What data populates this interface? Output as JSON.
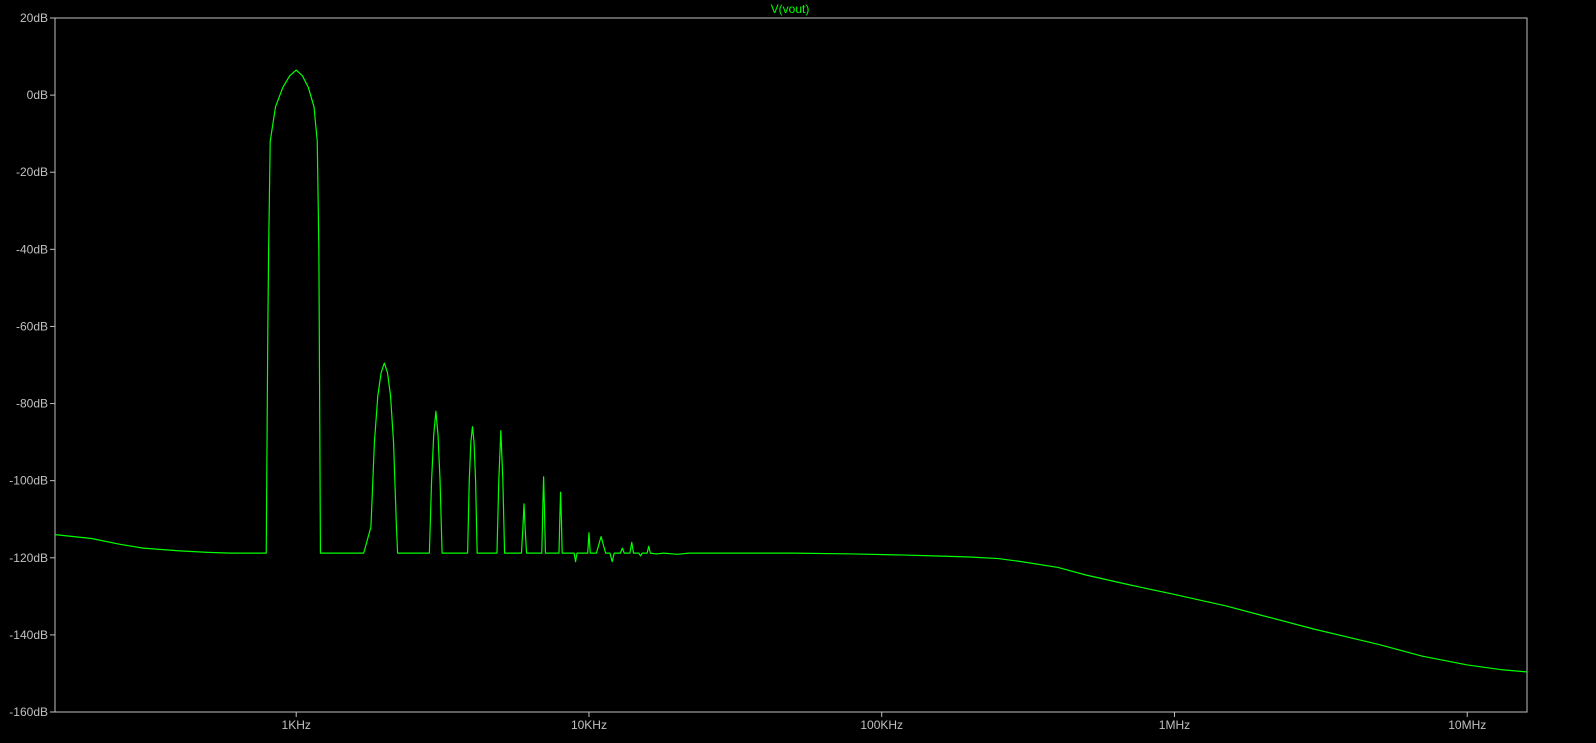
{
  "chart_data": {
    "type": "line",
    "title": "V(vout)",
    "xlabel": "",
    "ylabel": "",
    "x_scale": "log",
    "xlim": [
      150,
      16000000
    ],
    "ylim": [
      -160,
      20
    ],
    "grid": false,
    "colors": {
      "background": "#000000",
      "frame": "#c0c0c0",
      "trace": "#00ff00",
      "tick_label": "#c0c0c0"
    },
    "y_ticks": [
      {
        "value": 20,
        "label": "20dB"
      },
      {
        "value": 0,
        "label": "0dB"
      },
      {
        "value": -20,
        "label": "-20dB"
      },
      {
        "value": -40,
        "label": "-40dB"
      },
      {
        "value": -60,
        "label": "-60dB"
      },
      {
        "value": -80,
        "label": "-80dB"
      },
      {
        "value": -100,
        "label": "-100dB"
      },
      {
        "value": -120,
        "label": "-120dB"
      },
      {
        "value": -140,
        "label": "-140dB"
      },
      {
        "value": -160,
        "label": "-160dB"
      }
    ],
    "x_ticks": [
      {
        "value": 1000,
        "label": "1KHz"
      },
      {
        "value": 10000,
        "label": "10KHz"
      },
      {
        "value": 100000,
        "label": "100KHz"
      },
      {
        "value": 1000000,
        "label": "1MHz"
      },
      {
        "value": 10000000,
        "label": "10MHz"
      }
    ],
    "series": [
      {
        "name": "V(vout)",
        "points": [
          [
            150,
            -114
          ],
          [
            200,
            -115
          ],
          [
            250,
            -116.5
          ],
          [
            300,
            -117.5
          ],
          [
            400,
            -118.2
          ],
          [
            500,
            -118.6
          ],
          [
            600,
            -118.8
          ],
          [
            700,
            -118.8
          ],
          [
            780,
            -118.8
          ],
          [
            790,
            -118.8
          ],
          [
            800,
            -60
          ],
          [
            805,
            -40
          ],
          [
            815,
            -12
          ],
          [
            850,
            -3
          ],
          [
            900,
            2
          ],
          [
            950,
            5
          ],
          [
            1000,
            6.5
          ],
          [
            1050,
            5
          ],
          [
            1100,
            2
          ],
          [
            1150,
            -3
          ],
          [
            1180,
            -12
          ],
          [
            1195,
            -40
          ],
          [
            1210,
            -118.8
          ],
          [
            1700,
            -118.8
          ],
          [
            1800,
            -112
          ],
          [
            1850,
            -90
          ],
          [
            1900,
            -78
          ],
          [
            1950,
            -72
          ],
          [
            2000,
            -69.5
          ],
          [
            2050,
            -72
          ],
          [
            2100,
            -78
          ],
          [
            2150,
            -90
          ],
          [
            2200,
            -112
          ],
          [
            2220,
            -118.8
          ],
          [
            2850,
            -118.8
          ],
          [
            2900,
            -100
          ],
          [
            2950,
            -88
          ],
          [
            3000,
            -82
          ],
          [
            3050,
            -88
          ],
          [
            3100,
            -100
          ],
          [
            3150,
            -118.8
          ],
          [
            3850,
            -118.8
          ],
          [
            3900,
            -100
          ],
          [
            3950,
            -90
          ],
          [
            4000,
            -86
          ],
          [
            4050,
            -90
          ],
          [
            4100,
            -100
          ],
          [
            4150,
            -118.8
          ],
          [
            4850,
            -118.8
          ],
          [
            4920,
            -100
          ],
          [
            5000,
            -87
          ],
          [
            5080,
            -100
          ],
          [
            5150,
            -118.8
          ],
          [
            5880,
            -118.8
          ],
          [
            5950,
            -112
          ],
          [
            6000,
            -106
          ],
          [
            6050,
            -112
          ],
          [
            6120,
            -118.8
          ],
          [
            6900,
            -118.8
          ],
          [
            6950,
            -108
          ],
          [
            7000,
            -99
          ],
          [
            7050,
            -108
          ],
          [
            7100,
            -118.8
          ],
          [
            7900,
            -118.8
          ],
          [
            7950,
            -110
          ],
          [
            8000,
            -103
          ],
          [
            8050,
            -110
          ],
          [
            8100,
            -118.8
          ],
          [
            8900,
            -118.8
          ],
          [
            9000,
            -121
          ],
          [
            9100,
            -118.8
          ],
          [
            9900,
            -118.8
          ],
          [
            10000,
            -113.5
          ],
          [
            10100,
            -118.8
          ],
          [
            10600,
            -118.8
          ],
          [
            11000,
            -114.5
          ],
          [
            11400,
            -118.8
          ],
          [
            11800,
            -118.8
          ],
          [
            12000,
            -121
          ],
          [
            12200,
            -118.8
          ],
          [
            12800,
            -118.8
          ],
          [
            13000,
            -117.5
          ],
          [
            13200,
            -118.8
          ],
          [
            13800,
            -118.8
          ],
          [
            14000,
            -116
          ],
          [
            14200,
            -118.8
          ],
          [
            14800,
            -118.8
          ],
          [
            15000,
            -119.5
          ],
          [
            15200,
            -118.8
          ],
          [
            15800,
            -118.8
          ],
          [
            16000,
            -117
          ],
          [
            16200,
            -118.8
          ],
          [
            17000,
            -119
          ],
          [
            18000,
            -118.8
          ],
          [
            20000,
            -119.1
          ],
          [
            22000,
            -118.8
          ],
          [
            30000,
            -118.8
          ],
          [
            50000,
            -118.8
          ],
          [
            80000,
            -119
          ],
          [
            120000,
            -119.3
          ],
          [
            150000,
            -119.5
          ],
          [
            200000,
            -119.8
          ],
          [
            250000,
            -120.2
          ],
          [
            300000,
            -121
          ],
          [
            400000,
            -122.5
          ],
          [
            500000,
            -124.5
          ],
          [
            700000,
            -127
          ],
          [
            1000000,
            -129.5
          ],
          [
            1500000,
            -132.5
          ],
          [
            2000000,
            -135
          ],
          [
            3000000,
            -138.5
          ],
          [
            5000000,
            -142.5
          ],
          [
            7000000,
            -145.5
          ],
          [
            10000000,
            -147.8
          ],
          [
            13000000,
            -149
          ],
          [
            16000000,
            -149.6
          ]
        ]
      }
    ]
  }
}
